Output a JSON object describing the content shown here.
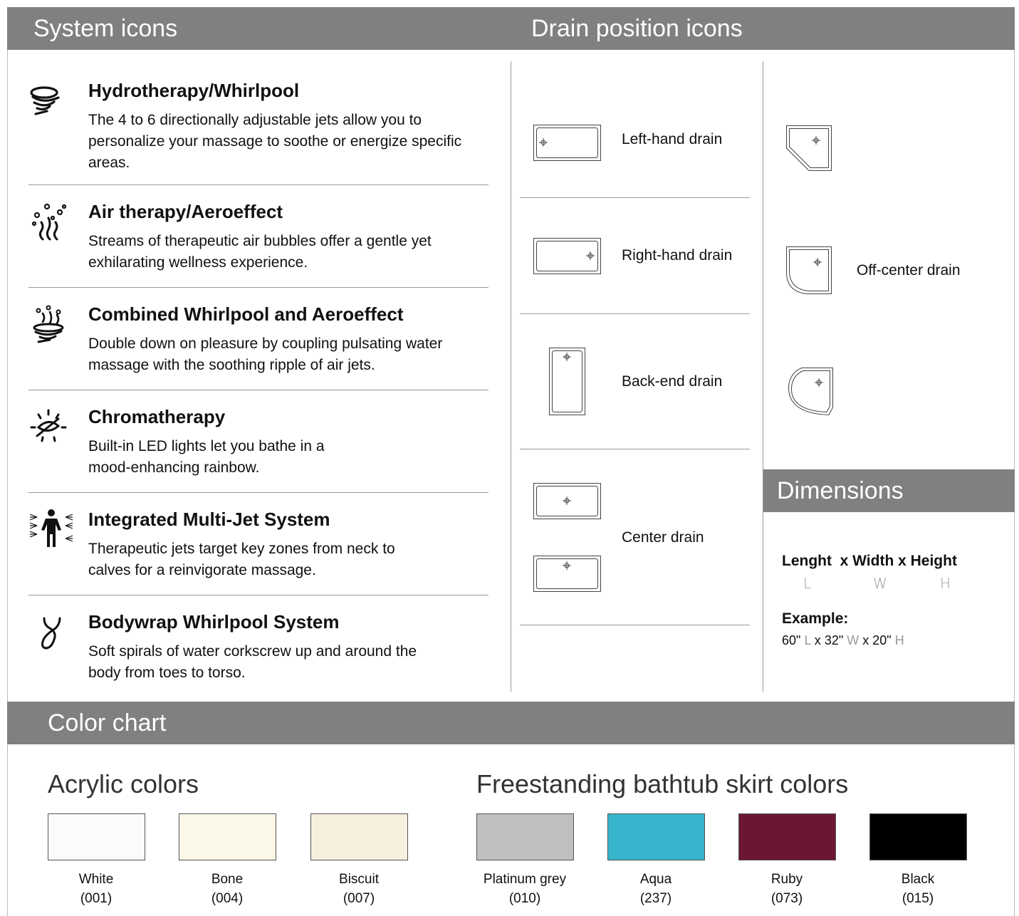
{
  "sections": {
    "system_icons": "System icons",
    "drain_position_icons": "Drain position icons",
    "dimensions": "Dimensions",
    "color_chart": "Color chart"
  },
  "systems": [
    {
      "title": "Hydrotherapy/Whirlpool",
      "description": "The 4 to 6 directionally adjustable jets allow you to personalize your massage to soothe or energize specific areas.",
      "icon": "whirlpool-icon"
    },
    {
      "title": "Air therapy/Aeroeffect",
      "description": "Streams of therapeutic air bubbles offer a gentle yet exhilarating wellness experience.",
      "icon": "air-bubbles-icon"
    },
    {
      "title": "Combined Whirlpool and Aeroeffect",
      "description": "Double down on pleasure by coupling pulsating water massage with the soothing ripple of air jets.",
      "icon": "combined-icon"
    },
    {
      "title": "Chromatherapy",
      "description": "Built-in LED lights let you bathe in a mood-enhancing rainbow.",
      "icon": "light-icon"
    },
    {
      "title": "Integrated Multi-Jet System",
      "description": "Therapeutic jets target key zones from neck to calves for a reinvigorate massage.",
      "icon": "multi-jet-person-icon"
    },
    {
      "title": "Bodywrap Whirlpool System",
      "description": "Soft spirals of water corkscrew up and around the body from toes to torso.",
      "icon": "bodywrap-spiral-icon"
    }
  ],
  "drains": {
    "left": "Left-hand drain",
    "right": "Right-hand drain",
    "back": "Back-end drain",
    "center": "Center drain",
    "off_center": "Off-center drain"
  },
  "dimensions": {
    "formula": "Lenght  x Width x Height",
    "letters": [
      "L",
      "W",
      "H"
    ],
    "example_label": "Example:",
    "example": {
      "l_value": "60\"",
      "l": "L",
      "x1": "x",
      "w_value": "32\"",
      "w": "W",
      "x2": "x",
      "h_value": "20\"",
      "h": "H"
    }
  },
  "acrylic": {
    "title": "Acrylic colors",
    "colors": [
      {
        "name": "White",
        "code": "(001)",
        "hex": "#fbfbf9"
      },
      {
        "name": "Bone",
        "code": "(004)",
        "hex": "#fbf8ea"
      },
      {
        "name": "Biscuit",
        "code": "(007)",
        "hex": "#f6efdd"
      }
    ]
  },
  "skirt": {
    "title": "Freestanding bathtub skirt colors",
    "colors": [
      {
        "name": "Platinum grey",
        "code": "(010)",
        "hex": "#bebfc1"
      },
      {
        "name": "Aqua",
        "code": "(237)",
        "hex": "#38b4cc"
      },
      {
        "name": "Ruby",
        "code": "(073)",
        "hex": "#6b1733"
      },
      {
        "name": "Black",
        "code": "(015)",
        "hex": "#000000"
      }
    ]
  }
}
